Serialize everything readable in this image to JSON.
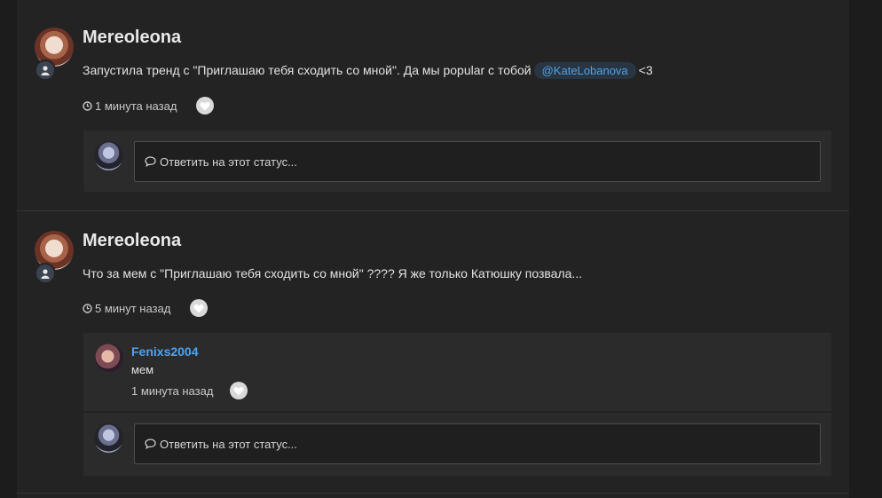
{
  "statuses": [
    {
      "author": "Mereoleona",
      "text_before": "Запустила тренд с \"Приглашаю тебя сходить со мной\". Да мы popular с тобой",
      "mention": "@KateLobanova",
      "text_after": "<3",
      "time": "1 минута назад",
      "reply_placeholder": "Ответить на этот статус..."
    },
    {
      "author": "Mereoleona",
      "text": "Что за мем с \"Приглашаю тебя сходить со мной\" ???? Я же только Катюшку позвала...",
      "time": "5 минут назад",
      "comment": {
        "author": "Fenixs2004",
        "text": "мем",
        "time": "1 минута назад"
      },
      "reply_placeholder": "Ответить на этот статус..."
    }
  ],
  "icons": {
    "clock": "clock-icon",
    "heart": "heart-icon",
    "user": "user-icon",
    "speech": "speech-bubble-icon"
  },
  "colors": {
    "background": "#1c1c1c",
    "panel": "#232323",
    "reply_area": "#2b2b2b",
    "link": "#4ea3f0",
    "mention_bg": "#2a3543"
  }
}
